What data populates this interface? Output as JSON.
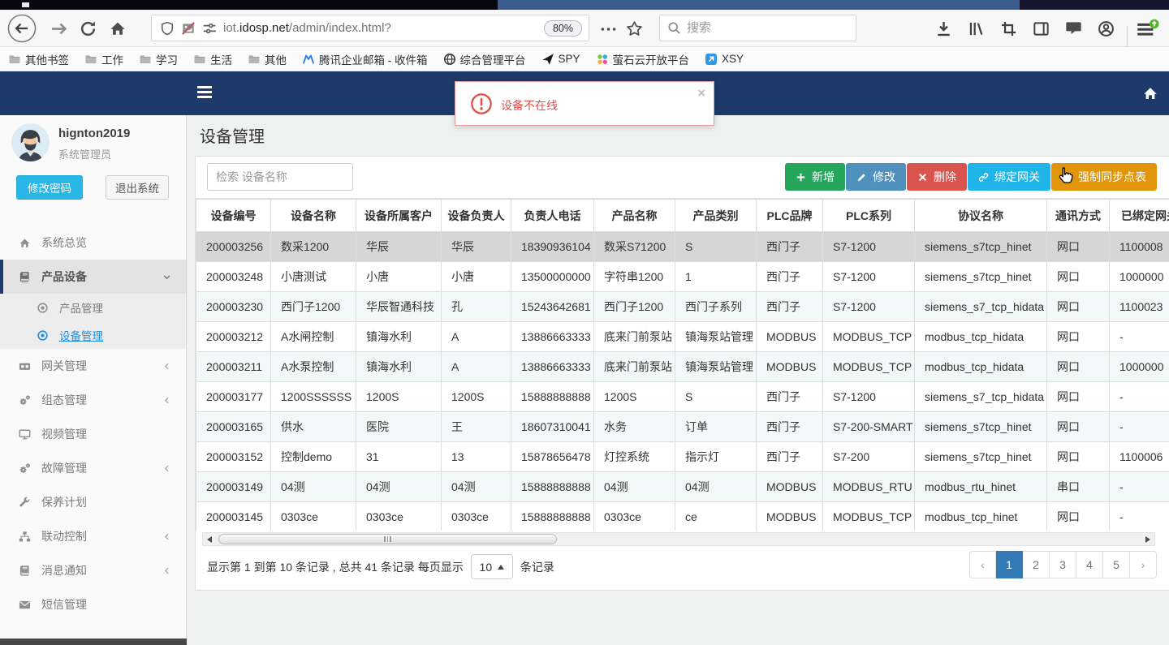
{
  "browser": {
    "url": {
      "prefix": "iot.",
      "domain": "idosp.net",
      "path": "/admin/index.html?"
    },
    "zoom_badge": "80%",
    "search_placeholder": "搜索",
    "bookmarks": [
      {
        "label": "其他书签",
        "icon": "folder-icon"
      },
      {
        "label": "工作",
        "icon": "folder-icon"
      },
      {
        "label": "学习",
        "icon": "folder-icon"
      },
      {
        "label": "生活",
        "icon": "folder-icon"
      },
      {
        "label": "其他",
        "icon": "folder-icon"
      },
      {
        "label": "腾讯企业邮箱 - 收件箱",
        "icon": "tencent-mail-icon"
      },
      {
        "label": "综合管理平台",
        "icon": "globe-icon"
      },
      {
        "label": "SPY",
        "icon": "plane-icon"
      },
      {
        "label": "萤石云开放平台",
        "icon": "dots-icon"
      },
      {
        "label": "XSY",
        "icon": "arrow-app-icon"
      }
    ]
  },
  "alert": {
    "message": "设备不在线"
  },
  "sidebar": {
    "user": {
      "name": "hignton2019",
      "role": "系统管理员"
    },
    "buttons": {
      "change_password": "修改密码",
      "logout": "退出系统"
    },
    "menu": [
      {
        "label": "系统总览",
        "icon": "home-icon"
      },
      {
        "label": "产品设备",
        "icon": "book-icon",
        "active": true,
        "chevron": "down"
      },
      {
        "label": "产品管理",
        "icon": "dot-circle-icon",
        "sub": true
      },
      {
        "label": "设备管理",
        "icon": "dot-circle-icon",
        "sub": true,
        "active": true
      },
      {
        "label": "网关管理",
        "icon": "video-icon",
        "chevron": "left"
      },
      {
        "label": "组态管理",
        "icon": "gears-icon",
        "chevron": "left"
      },
      {
        "label": "视频管理",
        "icon": "monitor-icon"
      },
      {
        "label": "故障管理",
        "icon": "gears-icon",
        "chevron": "left"
      },
      {
        "label": "保养计划",
        "icon": "wrench-icon"
      },
      {
        "label": "联动控制",
        "icon": "sitemap-icon",
        "chevron": "left"
      },
      {
        "label": "消息通知",
        "icon": "book-icon",
        "chevron": "left"
      },
      {
        "label": "短信管理",
        "icon": "envelope-icon"
      }
    ]
  },
  "main": {
    "title": "设备管理",
    "search_placeholder": "检索 设备名称",
    "toolbar": [
      {
        "name": "add-button",
        "label": "新增",
        "icon": "plus-icon",
        "color": "#26a65b"
      },
      {
        "name": "edit-button",
        "label": "修改",
        "icon": "pencil-icon",
        "color": "#4f90bc"
      },
      {
        "name": "delete-button",
        "label": "删除",
        "icon": "x-icon",
        "color": "#d9534f"
      },
      {
        "name": "bind-gateway-button",
        "label": "绑定网关",
        "icon": "link-icon",
        "color": "#1fb5e8"
      },
      {
        "name": "force-sync-button",
        "label": "强制同步点表",
        "icon": "refresh-icon",
        "color": "#e0950a"
      }
    ],
    "table": {
      "headers": [
        "设备编号",
        "设备名称",
        "设备所属客户",
        "设备负责人",
        "负责人电话",
        "产品名称",
        "产品类别",
        "PLC品牌",
        "PLC系列",
        "协议名称",
        "通讯方式",
        "已绑定网关"
      ],
      "rows": [
        [
          "200003256",
          "数采1200",
          "华辰",
          "华辰",
          "18390936104",
          "数采S71200",
          "S",
          "西门子",
          "S7-1200",
          "siemens_s7tcp_hinet",
          "网口",
          "1100008"
        ],
        [
          "200003248",
          "小唐测试",
          "小唐",
          "小唐",
          "13500000000",
          "字符串1200",
          "1",
          "西门子",
          "S7-1200",
          "siemens_s7tcp_hinet",
          "网口",
          "1000000"
        ],
        [
          "200003230",
          "西门子1200",
          "华辰智通科技",
          "孔",
          "15243642681",
          "西门子1200",
          "西门子系列",
          "西门子",
          "S7-1200",
          "siemens_s7_tcp_hidata",
          "网口",
          "1100023"
        ],
        [
          "200003212",
          "A水闸控制",
          "镇海水利",
          "A",
          "13886663333",
          "底来门前泵站",
          "镇海泵站管理",
          "MODBUS",
          "MODBUS_TCP",
          "modbus_tcp_hidata",
          "网口",
          "-"
        ],
        [
          "200003211",
          "A水泵控制",
          "镇海水利",
          "A",
          "13886663333",
          "底来门前泵站",
          "镇海泵站管理",
          "MODBUS",
          "MODBUS_TCP",
          "modbus_tcp_hidata",
          "网口",
          "1000000"
        ],
        [
          "200003177",
          "1200SSSSSS",
          "1200S",
          "1200S",
          "15888888888",
          "1200S",
          "S",
          "西门子",
          "S7-1200",
          "siemens_s7_tcp_hidata",
          "网口",
          "-"
        ],
        [
          "200003165",
          "供水",
          "医院",
          "王",
          "18607310041",
          "水务",
          "订单",
          "西门子",
          "S7-200-SMART",
          "siemens_s7tcp_hinet",
          "网口",
          "-"
        ],
        [
          "200003152",
          "控制demo",
          "31",
          "13",
          "15878656478",
          "灯控系统",
          "指示灯",
          "西门子",
          "S7-200",
          "siemens_s7tcp_hinet",
          "网口",
          "1100006"
        ],
        [
          "200003149",
          "04测",
          "04测",
          "04测",
          "15888888888",
          "04测",
          "04测",
          "MODBUS",
          "MODBUS_RTU",
          "modbus_rtu_hinet",
          "串口",
          "-"
        ],
        [
          "200003145",
          "0303ce",
          "0303ce",
          "0303ce",
          "15888888888",
          "0303ce",
          "ce",
          "MODBUS",
          "MODBUS_TCP",
          "modbus_tcp_hinet",
          "网口",
          "-"
        ]
      ],
      "selected_row": 0
    },
    "pagination": {
      "summary_start": "显示第 1 到第 10 条记录 , 总共 41 条记录 每页显示",
      "page_size": "10",
      "summary_end": "条记录",
      "prev": "‹",
      "next": "›",
      "pages": [
        "1",
        "2",
        "3",
        "4",
        "5"
      ],
      "active_page": "1"
    }
  },
  "colors": {
    "navbar": "#1d3a6b",
    "sidebar_accent": "#29b7e8",
    "active_link": "#1e8fe0",
    "alert_red": "#d9534f",
    "pagination_active": "#337ab7"
  }
}
